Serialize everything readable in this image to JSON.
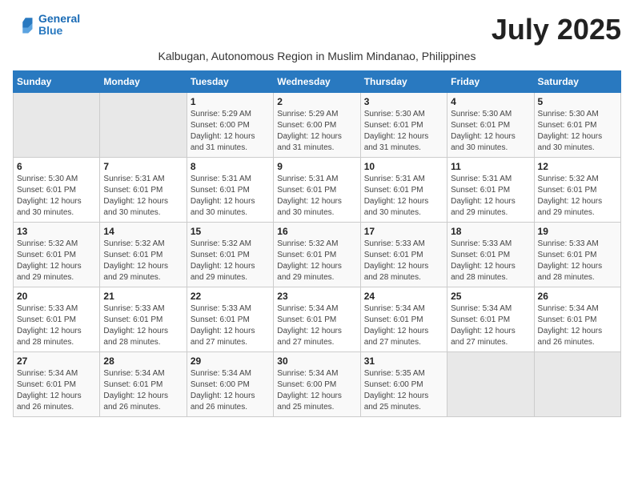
{
  "logo": {
    "line1": "General",
    "line2": "Blue"
  },
  "title": "July 2025",
  "subtitle": "Kalbugan, Autonomous Region in Muslim Mindanao, Philippines",
  "days_of_week": [
    "Sunday",
    "Monday",
    "Tuesday",
    "Wednesday",
    "Thursday",
    "Friday",
    "Saturday"
  ],
  "weeks": [
    [
      {
        "day": "",
        "detail": ""
      },
      {
        "day": "",
        "detail": ""
      },
      {
        "day": "1",
        "detail": "Sunrise: 5:29 AM\nSunset: 6:00 PM\nDaylight: 12 hours and 31 minutes."
      },
      {
        "day": "2",
        "detail": "Sunrise: 5:29 AM\nSunset: 6:00 PM\nDaylight: 12 hours and 31 minutes."
      },
      {
        "day": "3",
        "detail": "Sunrise: 5:30 AM\nSunset: 6:01 PM\nDaylight: 12 hours and 31 minutes."
      },
      {
        "day": "4",
        "detail": "Sunrise: 5:30 AM\nSunset: 6:01 PM\nDaylight: 12 hours and 30 minutes."
      },
      {
        "day": "5",
        "detail": "Sunrise: 5:30 AM\nSunset: 6:01 PM\nDaylight: 12 hours and 30 minutes."
      }
    ],
    [
      {
        "day": "6",
        "detail": "Sunrise: 5:30 AM\nSunset: 6:01 PM\nDaylight: 12 hours and 30 minutes."
      },
      {
        "day": "7",
        "detail": "Sunrise: 5:31 AM\nSunset: 6:01 PM\nDaylight: 12 hours and 30 minutes."
      },
      {
        "day": "8",
        "detail": "Sunrise: 5:31 AM\nSunset: 6:01 PM\nDaylight: 12 hours and 30 minutes."
      },
      {
        "day": "9",
        "detail": "Sunrise: 5:31 AM\nSunset: 6:01 PM\nDaylight: 12 hours and 30 minutes."
      },
      {
        "day": "10",
        "detail": "Sunrise: 5:31 AM\nSunset: 6:01 PM\nDaylight: 12 hours and 30 minutes."
      },
      {
        "day": "11",
        "detail": "Sunrise: 5:31 AM\nSunset: 6:01 PM\nDaylight: 12 hours and 29 minutes."
      },
      {
        "day": "12",
        "detail": "Sunrise: 5:32 AM\nSunset: 6:01 PM\nDaylight: 12 hours and 29 minutes."
      }
    ],
    [
      {
        "day": "13",
        "detail": "Sunrise: 5:32 AM\nSunset: 6:01 PM\nDaylight: 12 hours and 29 minutes."
      },
      {
        "day": "14",
        "detail": "Sunrise: 5:32 AM\nSunset: 6:01 PM\nDaylight: 12 hours and 29 minutes."
      },
      {
        "day": "15",
        "detail": "Sunrise: 5:32 AM\nSunset: 6:01 PM\nDaylight: 12 hours and 29 minutes."
      },
      {
        "day": "16",
        "detail": "Sunrise: 5:32 AM\nSunset: 6:01 PM\nDaylight: 12 hours and 29 minutes."
      },
      {
        "day": "17",
        "detail": "Sunrise: 5:33 AM\nSunset: 6:01 PM\nDaylight: 12 hours and 28 minutes."
      },
      {
        "day": "18",
        "detail": "Sunrise: 5:33 AM\nSunset: 6:01 PM\nDaylight: 12 hours and 28 minutes."
      },
      {
        "day": "19",
        "detail": "Sunrise: 5:33 AM\nSunset: 6:01 PM\nDaylight: 12 hours and 28 minutes."
      }
    ],
    [
      {
        "day": "20",
        "detail": "Sunrise: 5:33 AM\nSunset: 6:01 PM\nDaylight: 12 hours and 28 minutes."
      },
      {
        "day": "21",
        "detail": "Sunrise: 5:33 AM\nSunset: 6:01 PM\nDaylight: 12 hours and 28 minutes."
      },
      {
        "day": "22",
        "detail": "Sunrise: 5:33 AM\nSunset: 6:01 PM\nDaylight: 12 hours and 27 minutes."
      },
      {
        "day": "23",
        "detail": "Sunrise: 5:34 AM\nSunset: 6:01 PM\nDaylight: 12 hours and 27 minutes."
      },
      {
        "day": "24",
        "detail": "Sunrise: 5:34 AM\nSunset: 6:01 PM\nDaylight: 12 hours and 27 minutes."
      },
      {
        "day": "25",
        "detail": "Sunrise: 5:34 AM\nSunset: 6:01 PM\nDaylight: 12 hours and 27 minutes."
      },
      {
        "day": "26",
        "detail": "Sunrise: 5:34 AM\nSunset: 6:01 PM\nDaylight: 12 hours and 26 minutes."
      }
    ],
    [
      {
        "day": "27",
        "detail": "Sunrise: 5:34 AM\nSunset: 6:01 PM\nDaylight: 12 hours and 26 minutes."
      },
      {
        "day": "28",
        "detail": "Sunrise: 5:34 AM\nSunset: 6:01 PM\nDaylight: 12 hours and 26 minutes."
      },
      {
        "day": "29",
        "detail": "Sunrise: 5:34 AM\nSunset: 6:00 PM\nDaylight: 12 hours and 26 minutes."
      },
      {
        "day": "30",
        "detail": "Sunrise: 5:34 AM\nSunset: 6:00 PM\nDaylight: 12 hours and 25 minutes."
      },
      {
        "day": "31",
        "detail": "Sunrise: 5:35 AM\nSunset: 6:00 PM\nDaylight: 12 hours and 25 minutes."
      },
      {
        "day": "",
        "detail": ""
      },
      {
        "day": "",
        "detail": ""
      }
    ]
  ]
}
